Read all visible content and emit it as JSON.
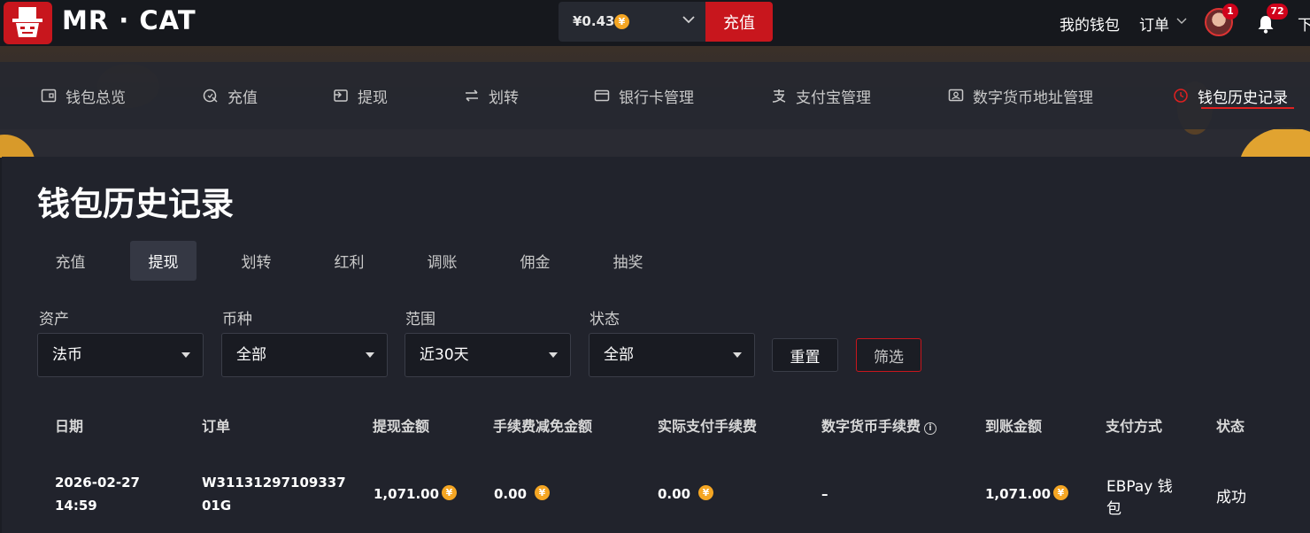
{
  "topbar": {
    "brand": "MR · CAT",
    "balance": "¥0.43",
    "coin_symbol": "¥",
    "recharge_label": "充值",
    "my_wallet": "我的钱包",
    "orders": "订单",
    "avatar_badge": "1",
    "notification_badge": "72",
    "cut_text": "下"
  },
  "wallet_nav": {
    "items": [
      {
        "label": "钱包总览",
        "icon": "wallet-icon"
      },
      {
        "label": "充值",
        "icon": "deposit-icon"
      },
      {
        "label": "提现",
        "icon": "withdraw-icon"
      },
      {
        "label": "划转",
        "icon": "transfer-icon"
      },
      {
        "label": "银行卡管理",
        "icon": "bank-card-icon"
      },
      {
        "label": "支付宝管理",
        "icon": "alipay-icon"
      },
      {
        "label": "数字货币地址管理",
        "icon": "crypto-address-icon"
      },
      {
        "label": "钱包历史记录",
        "icon": "history-clock-icon"
      }
    ],
    "active_index": 7
  },
  "page": {
    "title": "钱包历史记录",
    "tabs": [
      "充值",
      "提现",
      "划转",
      "红利",
      "调账",
      "佣金",
      "抽奖"
    ],
    "active_tab": 1
  },
  "filters": {
    "asset_label": "资产",
    "asset_value": "法币",
    "currency_label": "币种",
    "currency_value": "全部",
    "range_label": "范围",
    "range_value": "近30天",
    "status_label": "状态",
    "status_value": "全部",
    "reset_label": "重置",
    "filter_label": "筛选"
  },
  "table": {
    "headers": [
      "日期",
      "订单",
      "提现金额",
      "手续费减免金额",
      "实际支付手续费",
      "数字货币手续费",
      "到账金额",
      "支付方式",
      "状态"
    ],
    "info_glyph": "i",
    "rows": [
      {
        "date": "2026-02-27",
        "time": "14:59",
        "order_line1": "W31131297109337",
        "order_line2": "01G",
        "amount": "1,071.00",
        "fee_waived": "0.00",
        "fee_paid": "0.00",
        "crypto_fee": "–",
        "received": "1,071.00",
        "method_line1": "EBPay 钱",
        "method_line2": "包",
        "status": "成功"
      }
    ]
  },
  "colors": {
    "accent": "#c8161d",
    "coin": "#f5a623",
    "background": "#1b1d24"
  }
}
